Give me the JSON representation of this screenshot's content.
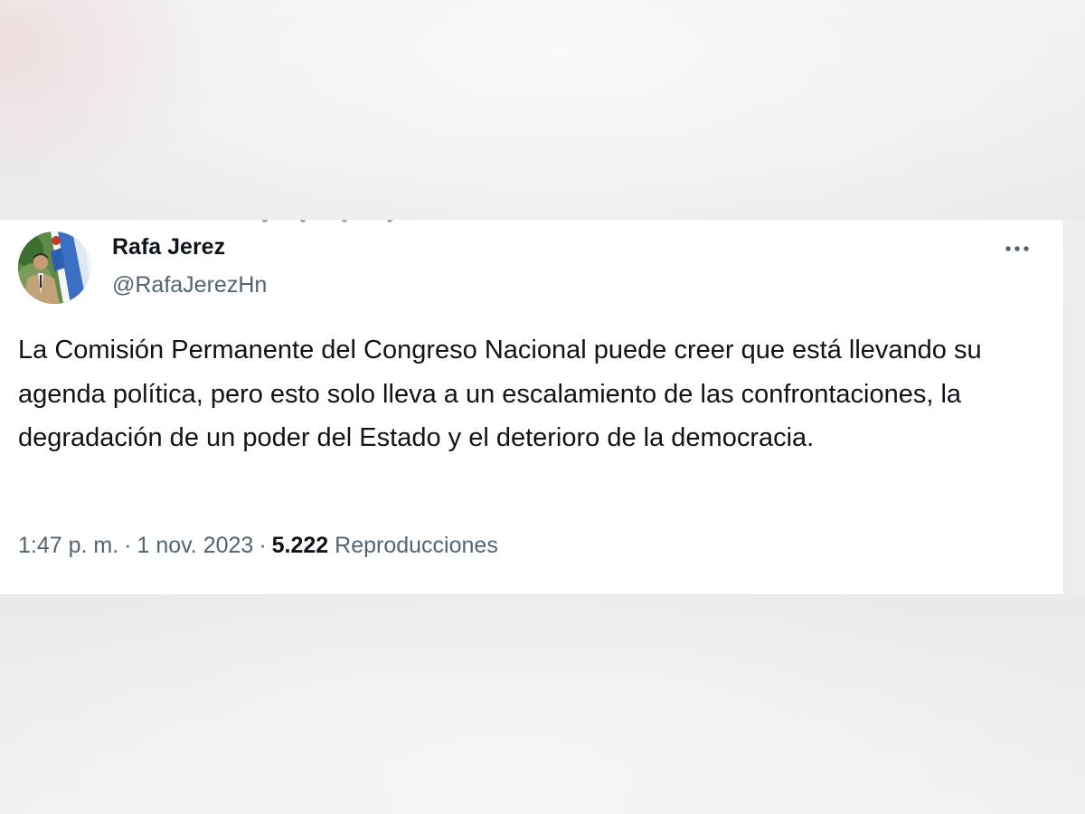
{
  "tweet": {
    "author": {
      "display_name": "Rafa Jerez",
      "handle": "@RafaJerezHn"
    },
    "more_icon": "more-horizontal-icon",
    "text": "La Comisión Permanente del Congreso Nacional puede creer que está llevando su agenda política, pero esto solo lleva a un escalamiento de las confrontaciones, la degradación de un poder del Estado y el deterioro de la democracia.",
    "time": "1:47 p. m.",
    "separator": "·",
    "date": "1 nov. 2023",
    "views_count": "5.222",
    "views_label": "Reproducciones"
  },
  "colors": {
    "text_primary": "#0f1419",
    "text_secondary": "#536471",
    "card_background": "#ffffff",
    "page_background": "#eeeeef"
  }
}
